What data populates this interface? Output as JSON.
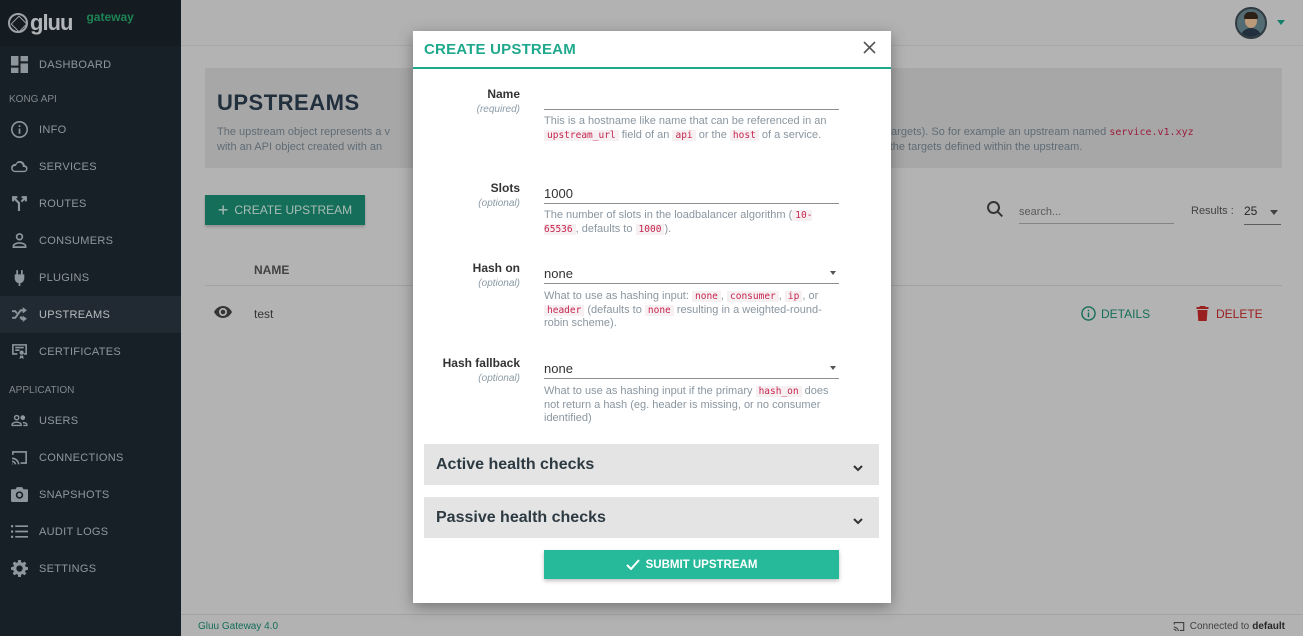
{
  "brand": {
    "name": "gluu",
    "sub": "gateway"
  },
  "sidebar": {
    "items": [
      {
        "label": "DASHBOARD",
        "icon": "dashboard-icon"
      },
      {
        "section": "KONG API"
      },
      {
        "label": "INFO",
        "icon": "info-icon"
      },
      {
        "label": "SERVICES",
        "icon": "cloud-icon"
      },
      {
        "label": "ROUTES",
        "icon": "routes-icon"
      },
      {
        "label": "CONSUMERS",
        "icon": "user-icon"
      },
      {
        "label": "PLUGINS",
        "icon": "plug-icon"
      },
      {
        "label": "UPSTREAMS",
        "icon": "shuffle-icon",
        "active": true
      },
      {
        "label": "CERTIFICATES",
        "icon": "certificate-icon"
      },
      {
        "section": "APPLICATION"
      },
      {
        "label": "USERS",
        "icon": "users-icon"
      },
      {
        "label": "CONNECTIONS",
        "icon": "cast-icon"
      },
      {
        "label": "SNAPSHOTS",
        "icon": "camera-icon"
      },
      {
        "label": "AUDIT LOGS",
        "icon": "list-icon"
      },
      {
        "label": "SETTINGS",
        "icon": "gear-icon"
      }
    ]
  },
  "page": {
    "title": "UPSTREAMS",
    "desc_1": "The upstream object represents a v",
    "desc_1b": "ces (targets). So for example an upstream named",
    "desc_code": "service.v1.xyz",
    "desc_2": "with an API object created with an",
    "desc_2b": "xied to the targets defined within the upstream.",
    "create_label": "CREATE UPSTREAM",
    "search_placeholder": "search...",
    "results_label": "Results :",
    "results_value": "25",
    "col_name": "NAME",
    "rows": [
      {
        "name": "test"
      }
    ],
    "details_label": "DETAILS",
    "delete_label": "DELETE"
  },
  "footer": {
    "version": "Gluu Gateway 4.0",
    "connected_prefix": "Connected to",
    "connected_value": "default"
  },
  "modal": {
    "title": "CREATE UPSTREAM",
    "name": {
      "label": "Name",
      "sub": "(required)",
      "value": "",
      "help_1": "This is a hostname like name that can be referenced in an",
      "code_1": "upstream_url",
      "help_2": "field of an",
      "code_2": "api",
      "help_3": "or the",
      "code_3": "host",
      "help_4": "of a service."
    },
    "slots": {
      "label": "Slots",
      "sub": "(optional)",
      "value": "1000",
      "help_1": "The number of slots in the loadbalancer algorithm (",
      "code_1": "10-65536",
      "help_2": ", defaults to",
      "code_2": "1000",
      "help_3": ")."
    },
    "hash_on": {
      "label": "Hash on",
      "sub": "(optional)",
      "value": "none",
      "help_1": "What to use as hashing input:",
      "code_1": "none",
      "sep_1": ",",
      "code_2": "consumer",
      "sep_2": ",",
      "code_3": "ip",
      "help_2": ", or",
      "code_4": "header",
      "help_3": "(defaults to",
      "code_5": "none",
      "help_4": "resulting in a weighted-round-robin scheme)."
    },
    "hash_fallback": {
      "label": "Hash fallback",
      "sub": "(optional)",
      "value": "none",
      "help_1": "What to use as hashing input if the primary",
      "code_1": "hash_on",
      "help_2": "does not return a hash (eg. header is missing, or no consumer identified)"
    },
    "active_title": "Active health checks",
    "passive_title": "Passive health checks",
    "submit_label": "SUBMIT UPSTREAM"
  }
}
